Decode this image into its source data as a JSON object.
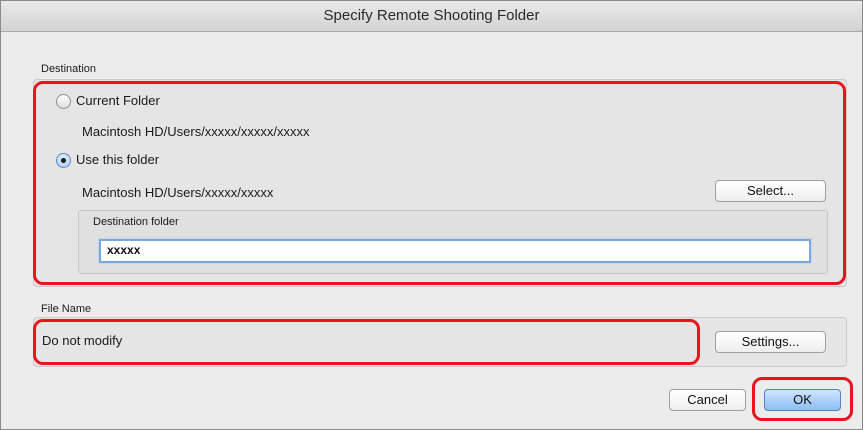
{
  "window": {
    "title": "Specify Remote Shooting Folder"
  },
  "destination": {
    "section_label": "Destination",
    "current_folder": {
      "label": "Current Folder",
      "path": "Macintosh HD/Users/xxxxx/xxxxx/xxxxx",
      "selected": false
    },
    "use_this_folder": {
      "label": "Use this folder",
      "path": "Macintosh HD/Users/xxxxx/xxxxx",
      "selected": true
    },
    "select_button": "Select...",
    "destination_folder": {
      "label": "Destination folder",
      "value": "xxxxx"
    }
  },
  "file_name": {
    "section_label": "File Name",
    "value": "Do not modify",
    "settings_button": "Settings..."
  },
  "footer": {
    "cancel_button": "Cancel",
    "ok_button": "OK"
  },
  "annotation_color": "#e8141e"
}
